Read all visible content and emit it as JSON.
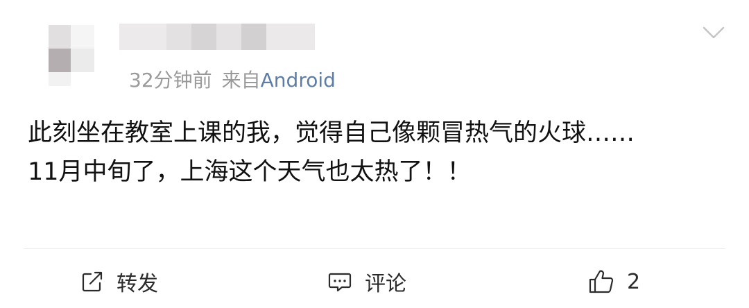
{
  "post": {
    "meta": {
      "time": "32分钟前",
      "source_label": "来自",
      "source": "Android"
    },
    "content": [
      "此刻坐在教室上课的我，觉得自己像颗冒热气的火球……",
      "11月中旬了，上海这个天气也太热了！！"
    ],
    "actions": {
      "repost_label": "转发",
      "comment_label": "评论",
      "like_count": "2"
    }
  },
  "icons": {
    "more": "chevron-down-icon",
    "repost": "share-icon",
    "comment": "comment-icon",
    "like": "thumbs-up-icon"
  },
  "colors": {
    "text": "#111111",
    "meta": "#9a9a9a",
    "source_link": "#5d7da6",
    "divider": "#ededed"
  }
}
